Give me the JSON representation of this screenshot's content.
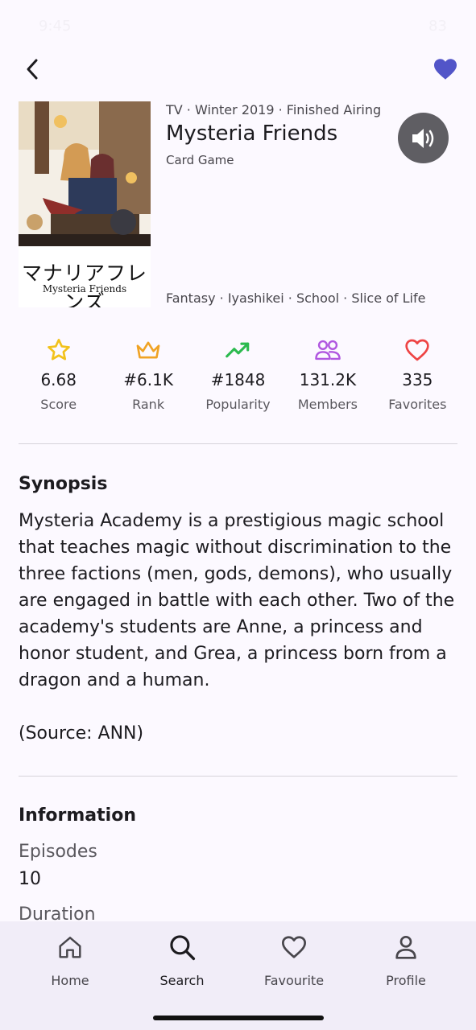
{
  "status_bar": {
    "time": "9:45",
    "battery": "83"
  },
  "anime": {
    "meta": "TV · Winter 2019 · Finished Airing",
    "title": "Mysteria Friends",
    "source": "Card Game",
    "genres": "Fantasy · Iyashikei · School · Slice of Life",
    "poster_title_jp": "マナリアフレンズ",
    "poster_title_en": "Mysteria Friends"
  },
  "stats": [
    {
      "icon": "star-icon",
      "value": "6.68",
      "label": "Score",
      "color": "#f2c21b"
    },
    {
      "icon": "crown-icon",
      "value": "#6.1K",
      "label": "Rank",
      "color": "#f0a324"
    },
    {
      "icon": "trending-up-icon",
      "value": "#1848",
      "label": "Popularity",
      "color": "#2cba4f"
    },
    {
      "icon": "members-icon",
      "value": "131.2K",
      "label": "Members",
      "color": "#b057e0"
    },
    {
      "icon": "heart-outline-icon",
      "value": "335",
      "label": "Favorites",
      "color": "#ee4444"
    }
  ],
  "synopsis": {
    "heading": "Synopsis",
    "text": "Mysteria Academy is a prestigious magic school that teaches magic without discrimination to the three factions (men, gods, demons), who usually are engaged in battle with each other. Two of the academy's students are Anne, a princess and honor student, and Grea, a princess born from a dragon and a human.",
    "source_note": "(Source: ANN)"
  },
  "information": {
    "heading": "Information",
    "episodes_label": "Episodes",
    "episodes_value": "10",
    "duration_label": "Duration"
  },
  "colors": {
    "accent": "#5255c8",
    "background": "#fcf9ff",
    "nav_background": "#f1edf8"
  },
  "bottom_nav": [
    {
      "icon": "home-icon",
      "label": "Home"
    },
    {
      "icon": "search-icon",
      "label": "Search",
      "active": true
    },
    {
      "icon": "heart-icon",
      "label": "Favourite"
    },
    {
      "icon": "person-icon",
      "label": "Profile"
    }
  ]
}
